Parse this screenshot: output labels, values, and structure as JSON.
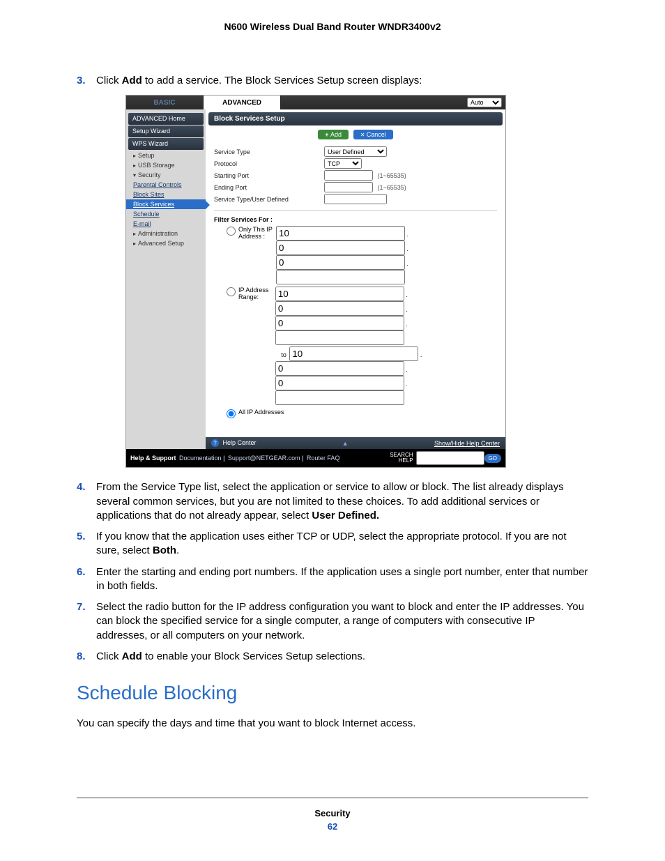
{
  "doc_title": "N600 Wireless Dual Band Router WNDR3400v2",
  "steps_before": [
    {
      "n": "3.",
      "html": "Click <b>Add</b> to add a service. The Block Services Setup screen displays:"
    }
  ],
  "steps_after": [
    {
      "n": "4.",
      "html": "From the Service Type list, select the application or service to allow or block. The list already displays several common services, but you are not limited to these choices. To add additional services or applications that do not already appear, select <b>User Defined.</b>"
    },
    {
      "n": "5.",
      "html": "If you know that the application uses either TCP or UDP, select the appropriate protocol. If you are not sure, select <b>Both</b>."
    },
    {
      "n": "6.",
      "html": "Enter the starting and ending port numbers. If the application uses a single port number, enter that number in both fields."
    },
    {
      "n": "7.",
      "html": " Select the radio button for the IP address configuration you want to block and enter the IP addresses. You can block the specified service for a single computer, a range of computers with consecutive IP addresses, or all computers on your network."
    },
    {
      "n": "8.",
      "html": "Click <b>Add</b> to enable your Block Services Setup selections."
    }
  ],
  "section_heading": "Schedule Blocking",
  "section_body": "You can specify the days and time that you want to block Internet access.",
  "footer_label": "Security",
  "footer_page": "62",
  "router": {
    "tabs": {
      "basic": "BASIC",
      "advanced": "ADVANCED",
      "lang": "Auto"
    },
    "sidebar": {
      "adv_home": "ADVANCED Home",
      "setup_wizard": "Setup Wizard",
      "wps_wizard": "WPS Wizard",
      "setup": "Setup",
      "usb": "USB Storage",
      "security": "Security",
      "parental": "Parental Controls",
      "block_sites": "Block Sites",
      "block_services": "Block Services",
      "schedule": "Schedule",
      "email": "E-mail",
      "admin": "Administration",
      "adv_setup": "Advanced Setup"
    },
    "panel_title": "Block Services Setup",
    "buttons": {
      "add": "Add",
      "cancel": "Cancel"
    },
    "form": {
      "service_type_label": "Service Type",
      "service_type_value": "User Defined",
      "protocol_label": "Protocol",
      "protocol_value": "TCP",
      "starting_port_label": "Starting Port",
      "ending_port_label": "Ending Port",
      "port_hint": "(1~65535)",
      "user_defined_label": "Service Type/User Defined",
      "filter_label": "Filter Services For :",
      "only_ip_label": "Only This IP Address :",
      "range_label": "IP Address Range:",
      "all_label": "All IP Addresses",
      "to_label": "to",
      "ip1": [
        "10",
        "0",
        "0",
        ""
      ],
      "ip_range_from": [
        "10",
        "0",
        "0",
        ""
      ],
      "ip_range_to": [
        "10",
        "0",
        "0",
        ""
      ]
    },
    "help": {
      "left": "Help Center",
      "right": "Show/Hide Help Center"
    },
    "footer": {
      "label": "Help & Support",
      "links": [
        "Documentation",
        "Support@NETGEAR.com",
        "Router FAQ"
      ],
      "search1": "SEARCH",
      "search2": "HELP",
      "go": "GO"
    }
  }
}
